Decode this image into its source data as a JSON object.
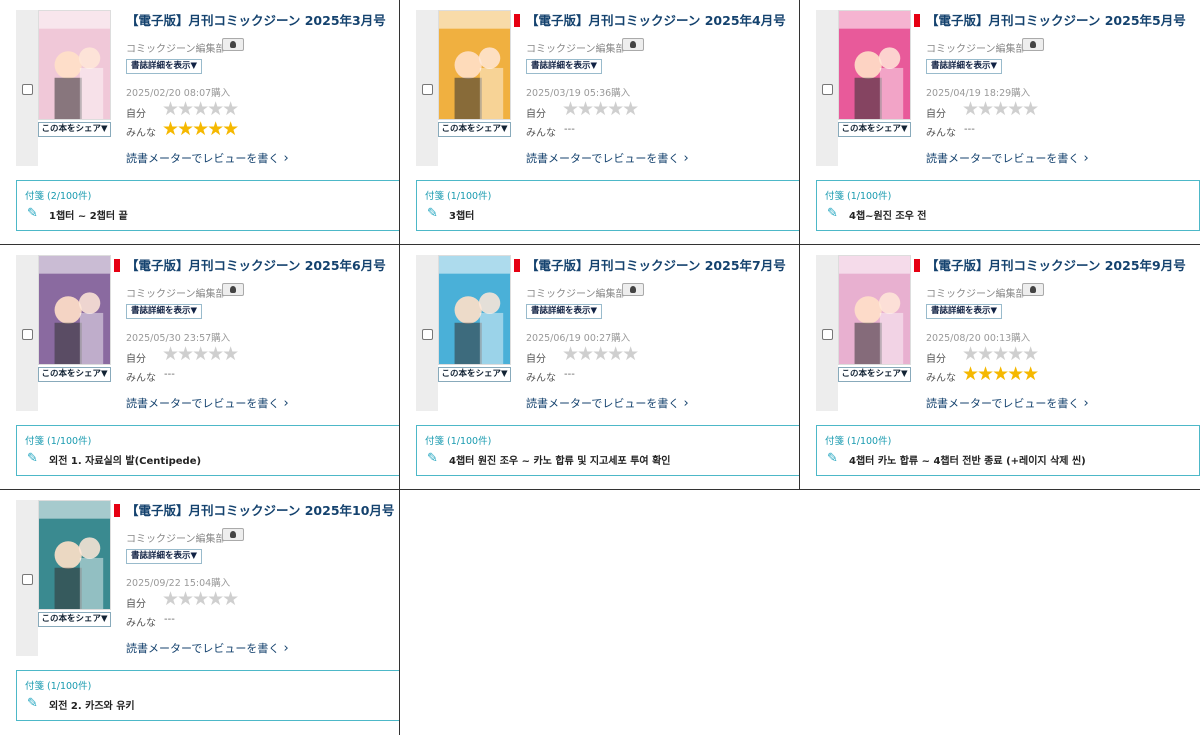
{
  "publisher_label": "コミックジーン編集部",
  "detail_label": "書誌詳細を表示▼",
  "share_label": "この本をシェア▼",
  "self_label": "自分",
  "everyone_label": "みんな",
  "review_label": "読書メーターでレビューを書く",
  "empty_rating": "---",
  "star_glyphs": "★★★★★",
  "accent_colors": {
    "title": "#14426e",
    "note_border": "#4db8c8",
    "star_on": "#f5b800",
    "flag": "#e60012"
  },
  "books": [
    {
      "title": "【電子版】月刊コミックジーン 2025年3月号",
      "purchased": "2025/02/20 08:07購入",
      "everyone_rating": 5,
      "everyone_text": "",
      "note_count": "付箋 (2/100件)",
      "note": "1챕터 ~ 2챕터 끝",
      "cover_color": "#f0c8d8",
      "has_flag": false
    },
    {
      "title": "【電子版】月刊コミックジーン 2025年4月号",
      "purchased": "2025/03/19 05:36購入",
      "everyone_rating": 0,
      "everyone_text": "---",
      "note_count": "付箋 (1/100件)",
      "note": "3챕터",
      "cover_color": "#f0b040",
      "has_flag": true
    },
    {
      "title": "【電子版】月刊コミックジーン 2025年5月号",
      "purchased": "2025/04/19 18:29購入",
      "everyone_rating": 0,
      "everyone_text": "---",
      "note_count": "付箋 (1/100件)",
      "note": "4챕~원진 조우 전",
      "cover_color": "#e85a9a",
      "has_flag": true
    },
    {
      "title": "【電子版】月刊コミックジーン 2025年6月号",
      "purchased": "2025/05/30 23:57購入",
      "everyone_rating": 0,
      "everyone_text": "---",
      "note_count": "付箋 (1/100件)",
      "note": "외전 1. 자료실의 발(Centipede)",
      "cover_color": "#8a6aa0",
      "has_flag": true
    },
    {
      "title": "【電子版】月刊コミックジーン 2025年7月号",
      "purchased": "2025/06/19 00:27購入",
      "everyone_rating": 0,
      "everyone_text": "---",
      "note_count": "付箋 (1/100件)",
      "note": "4챕터 원진 조우 ~ 카노 합류 및 지고세포 투여 확인",
      "cover_color": "#4ab0d8",
      "has_flag": true
    },
    {
      "title": "【電子版】月刊コミックジーン 2025年9月号",
      "purchased": "2025/08/20 00:13購入",
      "everyone_rating": 5,
      "everyone_text": "",
      "note_count": "付箋 (1/100件)",
      "note": "4챕터 카노 합류 ~ 4챕터 전반 종료 (+레이지 삭제 씬)",
      "cover_color": "#e8b0d0",
      "has_flag": true
    },
    {
      "title": "【電子版】月刊コミックジーン 2025年10月号",
      "purchased": "2025/09/22 15:04購入",
      "everyone_rating": 0,
      "everyone_text": "---",
      "note_count": "付箋 (1/100件)",
      "note": "외전 2. 카즈와 유키",
      "cover_color": "#3a8a90",
      "has_flag": true
    }
  ]
}
